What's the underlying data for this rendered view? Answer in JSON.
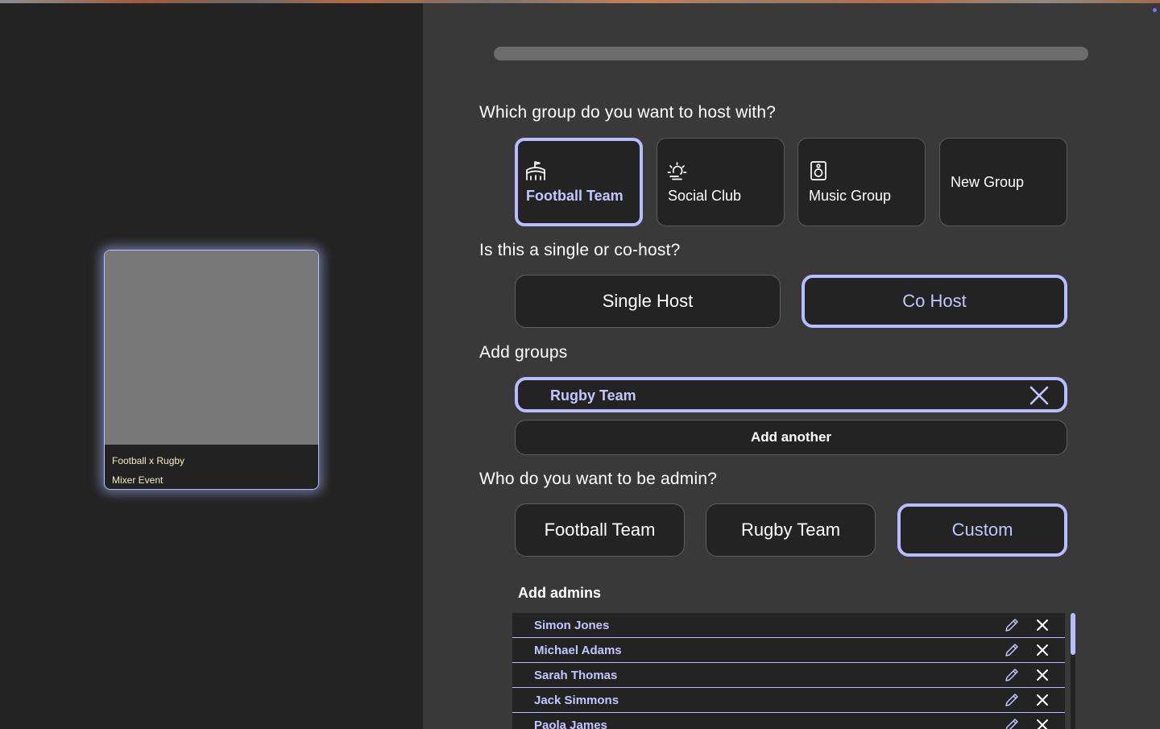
{
  "preview": {
    "caption_line1": "Football x Rugby",
    "caption_line2": "Mixer Event"
  },
  "host_group": {
    "question": "Which group do you want to host with?",
    "options": [
      {
        "label": "Football Team",
        "icon": "stadium-icon",
        "selected": true
      },
      {
        "label": "Social Club",
        "icon": "sun-icon",
        "selected": false
      },
      {
        "label": "Music Group",
        "icon": "speaker-icon",
        "selected": false
      },
      {
        "label": "New Group",
        "icon": "",
        "selected": false
      }
    ]
  },
  "host_type": {
    "question": "Is this a single or co-host?",
    "options": [
      {
        "label": "Single Host",
        "selected": false
      },
      {
        "label": "Co Host",
        "selected": true
      }
    ]
  },
  "add_groups": {
    "question": "Add groups",
    "groups": [
      {
        "label": "Rugby Team"
      }
    ],
    "add_another_label": "Add another"
  },
  "admin": {
    "question": "Who do you want to be admin?",
    "options": [
      {
        "label": "Football Team",
        "selected": false
      },
      {
        "label": "Rugby Team",
        "selected": false
      },
      {
        "label": "Custom",
        "selected": true
      }
    ],
    "add_admins_label": "Add admins",
    "admins": [
      {
        "name": "Simon Jones"
      },
      {
        "name": "Michael Adams"
      },
      {
        "name": "Sarah Thomas"
      },
      {
        "name": "Jack Simmons"
      },
      {
        "name": "Paola James"
      }
    ]
  },
  "colors": {
    "accent": "#b9bcff",
    "accent_text": "#c4c6ff",
    "panel": "#393939",
    "surface": "#232323"
  }
}
